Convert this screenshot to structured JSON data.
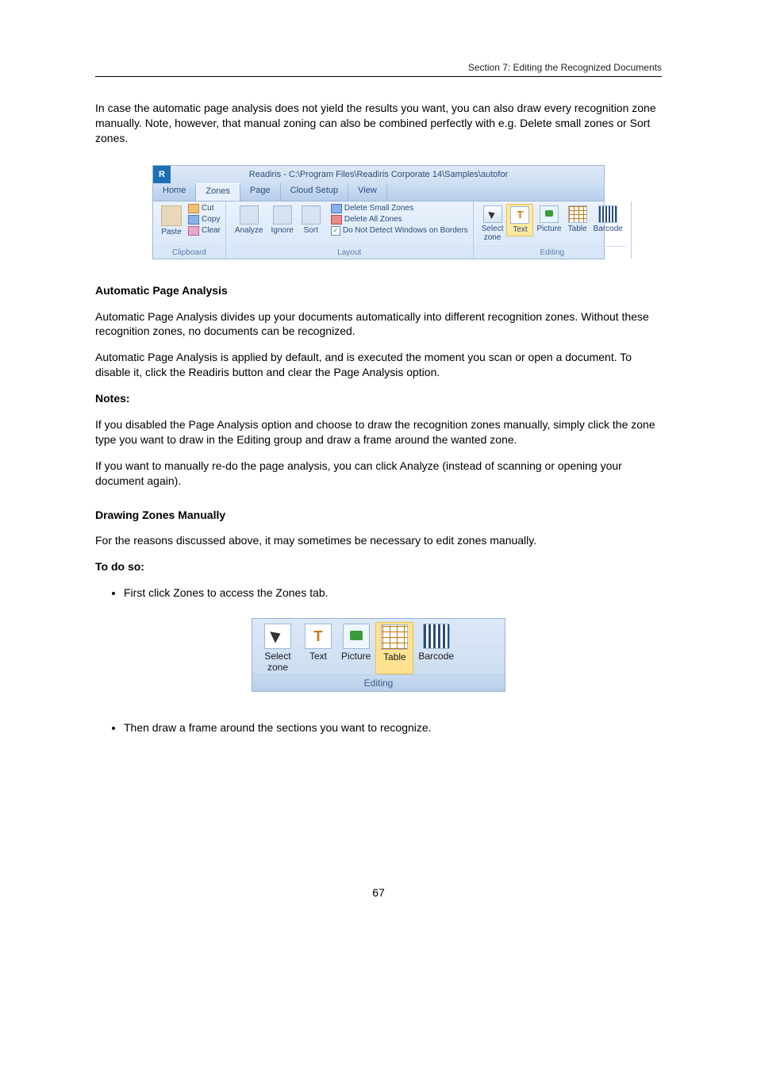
{
  "header": {
    "running": "Section 7: Editing the Recognized Documents"
  },
  "intro": "In case the automatic page analysis does not yield the results you want, you can also draw every recognition zone manually. Note, however, that manual zoning can also be combined perfectly with e.g. Delete small zones or Sort zones.",
  "ribbon": {
    "title": "Readiris - C:\\Program Files\\Readiris Corporate 14\\Samples\\autofor",
    "tabs": [
      "Home",
      "Zones",
      "Page",
      "Cloud Setup",
      "View"
    ],
    "activeTab": "Zones",
    "clipboard": {
      "paste": "Paste",
      "cut": "Cut",
      "copy": "Copy",
      "clear": "Clear",
      "label": "Clipboard"
    },
    "layout": {
      "analyze": "Analyze",
      "ignore": "Ignore",
      "sort": "Sort",
      "delSmall": "Delete Small Zones",
      "delAll": "Delete All Zones",
      "dnd": "Do Not Detect Windows on Borders",
      "label": "Layout"
    },
    "editing": {
      "select": "Select zone",
      "text": "Text",
      "picture": "Picture",
      "table": "Table",
      "barcode": "Barcode",
      "label": "Editing"
    }
  },
  "analysisHeading": "Automatic Page Analysis",
  "analysis": {
    "p1": "Automatic Page Analysis divides up your documents automatically into different recognition zones. Without these recognition zones, no documents can be recognized.",
    "p2": "Automatic Page Analysis is applied by default, and is executed the moment you scan or open a document. To disable it, click the Readiris button and clear the Page Analysis option.",
    "p3bold": "Notes:",
    "p4": "If you disabled the Page Analysis option and choose to draw the recognition zones manually, simply click the zone type you want to draw in the Editing group and draw a frame around the wanted zone.",
    "p5": "If you want to manually re-do the page analysis, you can click Analyze (instead of scanning or opening your document again)."
  },
  "manualHeading": "Drawing Zones Manually",
  "manual": {
    "p1": "For the reasons discussed above, it may sometimes be necessary to edit zones manually.",
    "toDo": "To do so:",
    "step1": "First click Zones to access the Zones tab."
  },
  "editingPanel": {
    "select": "Select zone",
    "text": "Text",
    "picture": "Picture",
    "table": "Table",
    "barcode": "Barcode",
    "label": "Editing"
  },
  "afterPanel": "Then draw a frame around the sections you want to recognize.",
  "pageNum": "67"
}
